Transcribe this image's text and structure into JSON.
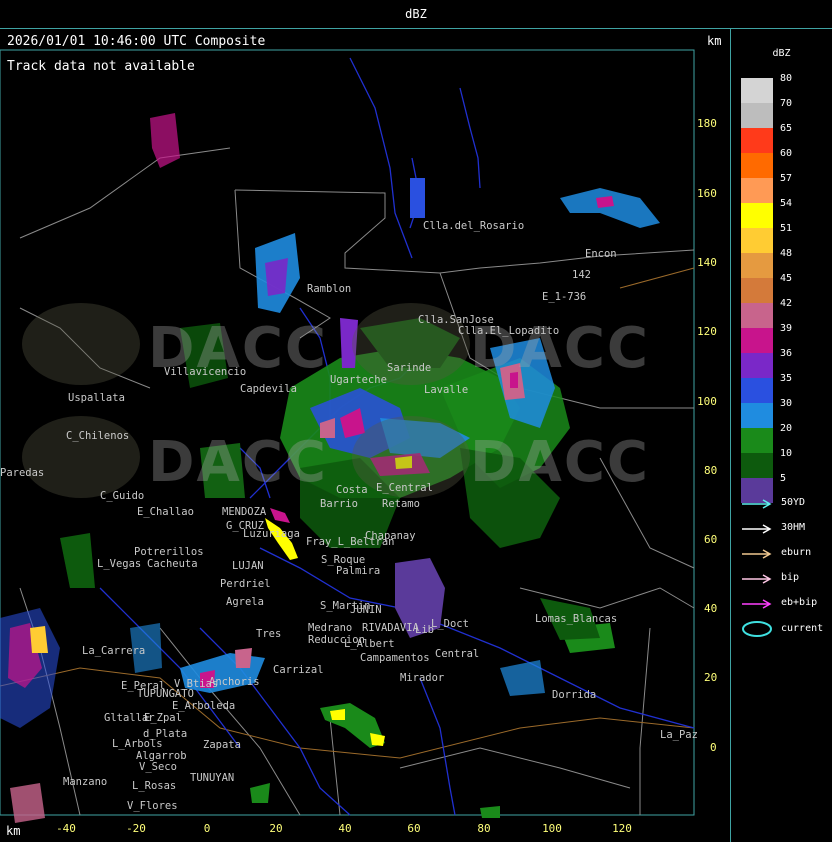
{
  "window": {
    "title": "dBZ"
  },
  "header": {
    "timestamp_line": "2026/01/01 10:46:00 UTC Composite",
    "status_line": "Track data not available",
    "km_label_top": "km",
    "km_label_bottom": "km"
  },
  "y_axis_ticks": [
    "180",
    "160",
    "140",
    "120",
    "100",
    "80",
    "60",
    "40",
    "20",
    "0"
  ],
  "x_axis_ticks": [
    "-40",
    "-20",
    "0",
    "20",
    "40",
    "60",
    "80",
    "100",
    "120"
  ],
  "legend": {
    "title": "dBZ",
    "scale": [
      {
        "label": "80",
        "color": "#d4d4d4"
      },
      {
        "label": "70",
        "color": "#bdbdbd"
      },
      {
        "label": "65",
        "color": "#ff3a1a"
      },
      {
        "label": "60",
        "color": "#ff6a00"
      },
      {
        "label": "57",
        "color": "#ff9a55"
      },
      {
        "label": "54",
        "color": "#ffff00"
      },
      {
        "label": "51",
        "color": "#ffcc33"
      },
      {
        "label": "48",
        "color": "#e59a40"
      },
      {
        "label": "45",
        "color": "#d47a3a"
      },
      {
        "label": "42",
        "color": "#c8648c"
      },
      {
        "label": "39",
        "color": "#c8148c"
      },
      {
        "label": "36",
        "color": "#7a28c8"
      },
      {
        "label": "35",
        "color": "#2a50e0"
      },
      {
        "label": "30",
        "color": "#1f8ce0"
      },
      {
        "label": "20",
        "color": "#1a8a1a"
      },
      {
        "label": "10",
        "color": "#0d5a0d"
      },
      {
        "label": "5",
        "color": "#5a3a9a"
      }
    ],
    "tracks": [
      {
        "label": "50YD",
        "color": "#5ff0f0"
      },
      {
        "label": "30HM",
        "color": "#ffffff"
      },
      {
        "label": "eburn",
        "color": "#f0c890"
      },
      {
        "label": "bip",
        "color": "#ffc8e6"
      },
      {
        "label": "eb+bip",
        "color": "#ff40ff"
      }
    ],
    "current_label": "current",
    "current_color": "#3fe0e0"
  },
  "watermarks": [
    "DACC",
    "DACC",
    "DACC",
    "DACC"
  ],
  "places": [
    "Clla.del_Rosario",
    "Encon",
    "142",
    "E_1-736",
    "Ramblon",
    "Clla.SanJose",
    "Clla.El_Lopadito",
    "Villavicencio",
    "Uspallata",
    "Capdevila",
    "Sarinde",
    "C_Chilenos",
    "Paredas",
    "C_Guido",
    "E_Challao",
    "MENDOZA",
    "G_CRUZ",
    "Luzuriaga",
    "Potrerillos",
    "Cacheuta",
    "L_Vegas",
    "Perdriel",
    "LUJAN",
    "Agrela",
    "Tres",
    "S_Martin",
    "Medrano",
    "Reduccion",
    "RIVADAVIA",
    "Lib",
    "L_Albert",
    "Campamentos",
    "Central",
    "Mirador",
    "L_Doct",
    "La_Paz",
    "Lomas_Blancas",
    "Dorrida",
    "La_Carrera",
    "Carrizal",
    "Anchoris",
    "TUPUNGATO",
    "V_Btias",
    "E_Peral",
    "Gltallar",
    "E_Zpal",
    "E_Arboleda",
    "d_Plata",
    "L_Arbols",
    "Algarrob",
    "Zapata",
    "V_Seco",
    "TUNUYAN",
    "Manzano",
    "L_Rosas",
    "V_Flores",
    "JUNIN",
    "S_Roque",
    "Palmira",
    "Chapanay",
    "Fray_L_Beltran",
    "E_Central",
    "Lavalle",
    "Costa",
    "Barrio",
    "Ugarteche",
    "Retamo"
  ]
}
